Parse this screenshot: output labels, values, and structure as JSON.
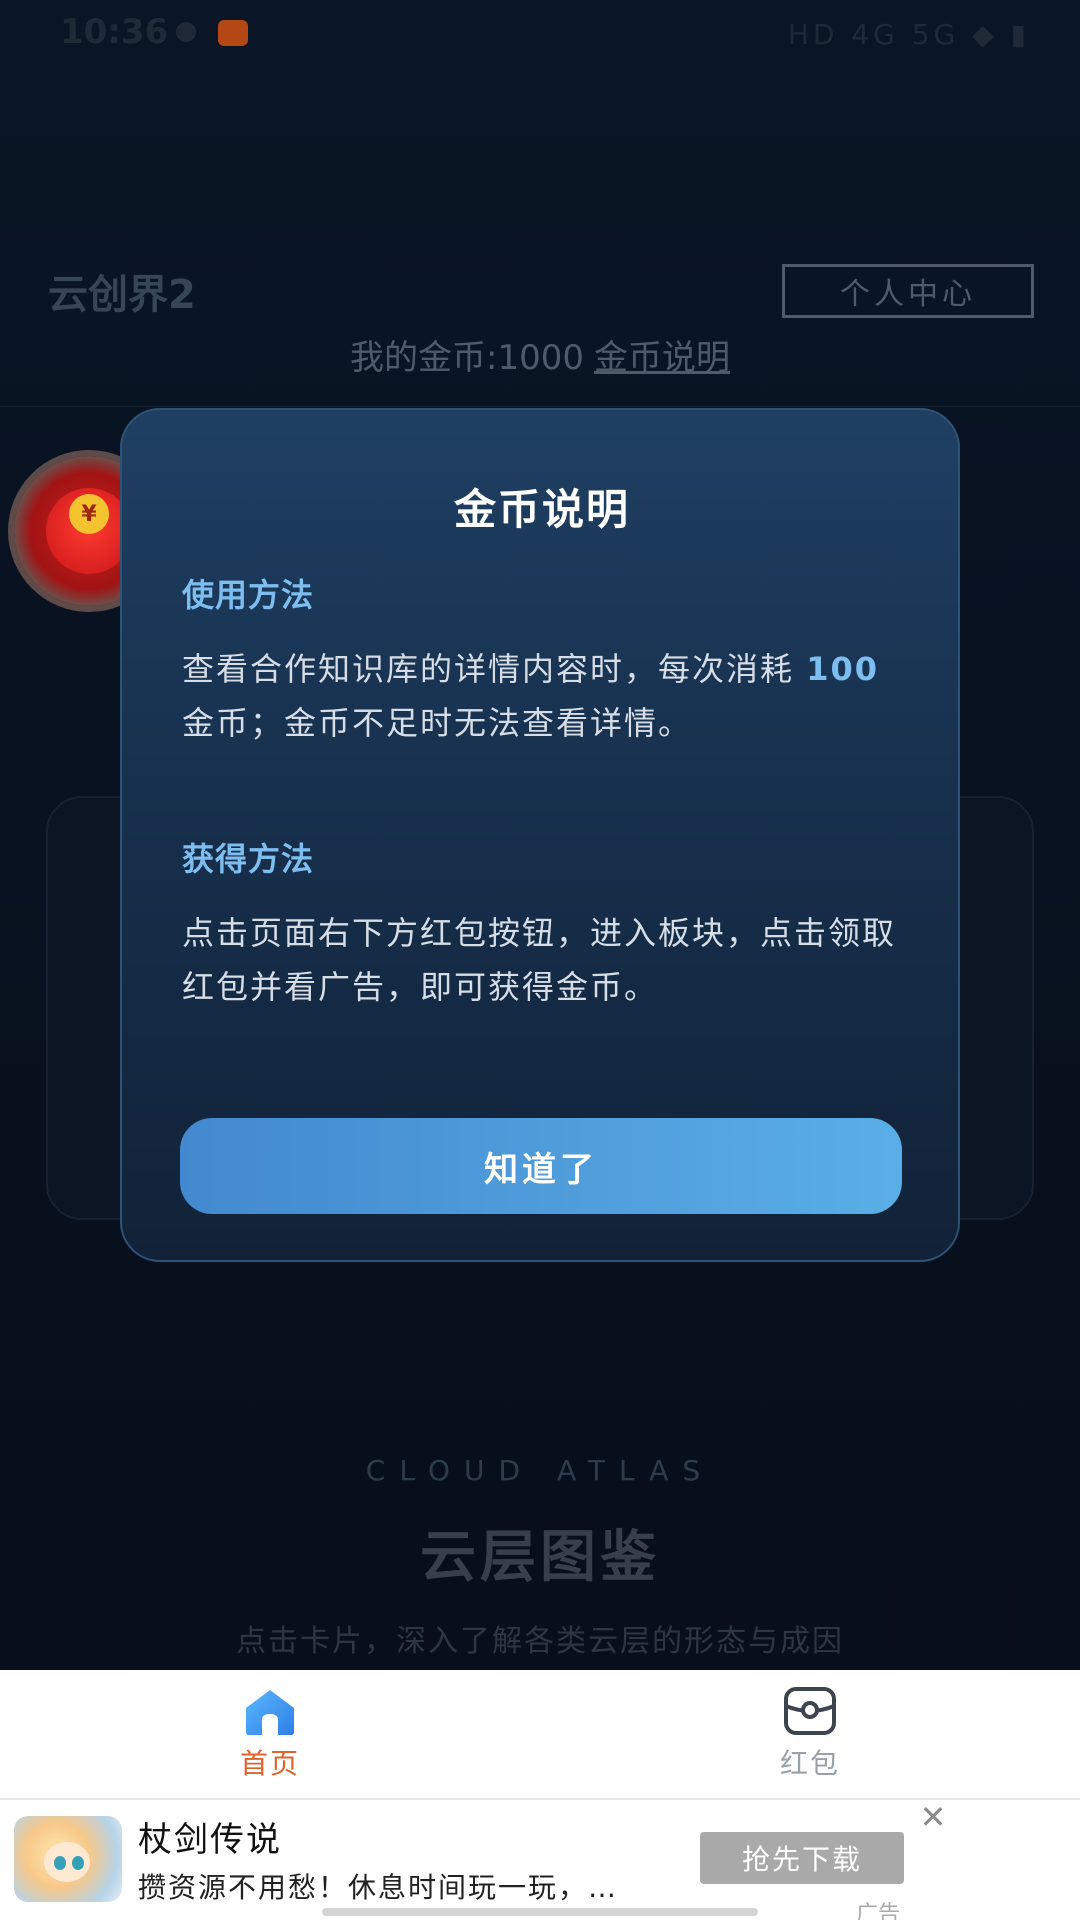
{
  "status_bar": {
    "time": "10:36",
    "right_icons": "HD 4G 5G ◆ ▮"
  },
  "header": {
    "app_title": "云创界2",
    "profile_button": "个人中心",
    "coins_text": "我的金币:1000",
    "coins_link": "金币说明"
  },
  "atlas": {
    "english": "CLOUD ATLAS",
    "title": "云层图鉴",
    "subtitle": "点击卡片，深入了解各类云层的形态与成因"
  },
  "modal": {
    "title": "金币说明",
    "usage_heading": "使用方法",
    "usage_text_pre": "查看合作知识库的详情内容时，每次消耗 ",
    "usage_cost": "100",
    "usage_text_post": " 金币；金币不足时无法查看详情。",
    "earn_heading": "获得方法",
    "earn_text": "点击页面右下方红包按钮，进入板块，点击领取红包并看广告，即可获得金币。",
    "confirm_button": "知道了"
  },
  "tabbar": {
    "tabs": [
      {
        "label": "首页",
        "icon": "home-icon",
        "active": true
      },
      {
        "label": "红包",
        "icon": "red-packet-icon",
        "active": false
      }
    ]
  },
  "ad": {
    "title": "杖剑传说",
    "description": "攒资源不用愁！休息时间玩一玩，…",
    "button": "抢先下载",
    "close": "✕",
    "label": "广告"
  },
  "red_packet": {
    "coin_symbol": "¥"
  },
  "colors": {
    "accent_blue": "#5aaee6",
    "section_heading": "#7dbdf0",
    "active_tab": "#e0632e"
  }
}
